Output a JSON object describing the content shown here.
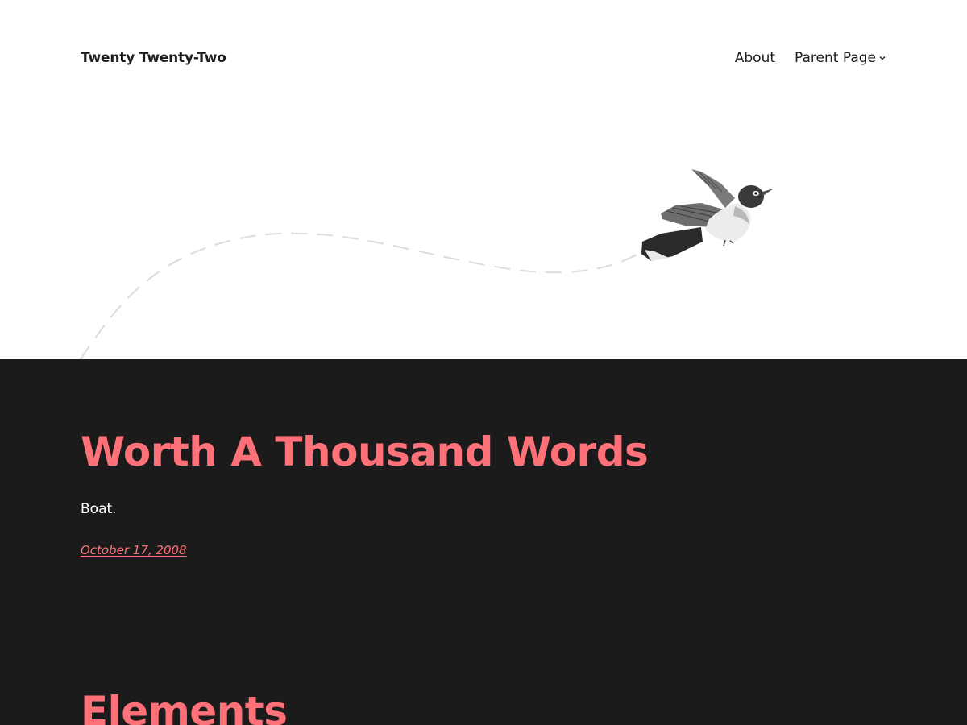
{
  "header": {
    "site_title": "Twenty Twenty-Two",
    "nav": {
      "items": [
        {
          "label": "About"
        },
        {
          "label": "Parent Page",
          "icon": "chevron-down-icon"
        }
      ]
    },
    "hero_image": "bird-flying-illustration"
  },
  "posts": [
    {
      "title": "Worth A Thousand Words",
      "excerpt": "Boat.",
      "date": "October 17, 2008"
    }
  ],
  "next_section": {
    "title": "Elements"
  },
  "colors": {
    "background_light": "#ffffff",
    "background_dark": "#1c1b1c",
    "accent": "#ff7179",
    "text_dark": "#1c1c1c",
    "text_light": "#ffffff"
  }
}
